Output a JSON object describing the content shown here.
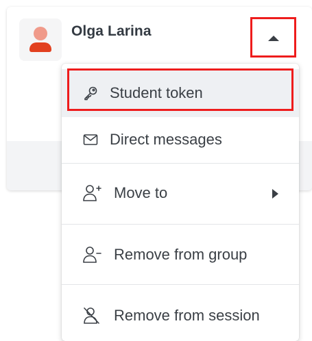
{
  "user": {
    "name": "Olga Larina",
    "avatar_colors": {
      "head": "#f09a8a",
      "body": "#e2401f",
      "background": "#f5f5f6"
    }
  },
  "toggle": {
    "icon": "caret-up-icon",
    "highlight_color": "#ee1c1c"
  },
  "menu": {
    "items": [
      {
        "label": "Student token",
        "icon": "key-icon",
        "highlighted": true
      },
      {
        "label": "Direct messages",
        "icon": "envelope-icon"
      },
      {
        "label": "Move to",
        "icon": "user-plus-icon",
        "submenu_icon": "caret-right-icon"
      },
      {
        "label": "Remove from group",
        "icon": "user-minus-icon"
      },
      {
        "label": "Remove from session",
        "icon": "user-slash-icon"
      }
    ]
  },
  "colors": {
    "text": "#3a3f45",
    "name_text": "#333a42",
    "highlight_row": "#eef0f3",
    "annotation_red": "#ee1c1c"
  }
}
